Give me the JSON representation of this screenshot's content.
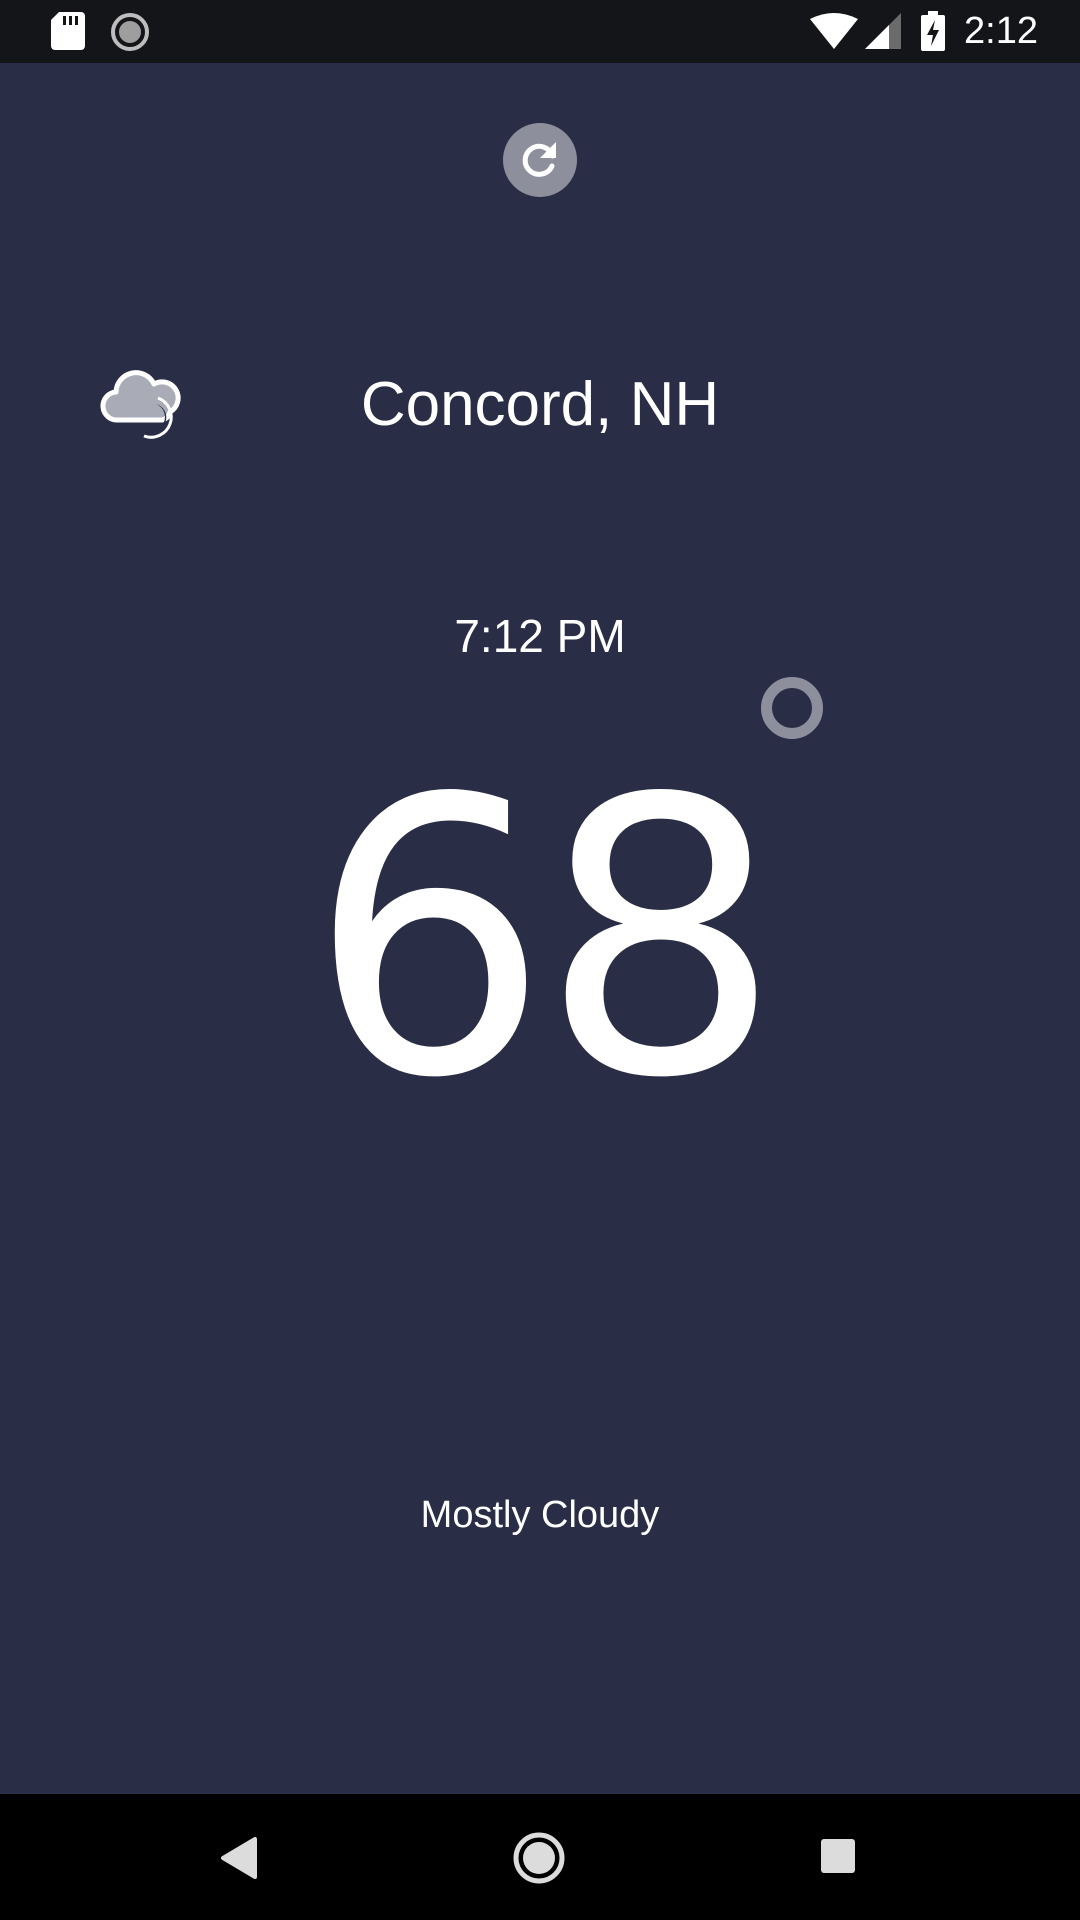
{
  "status_bar": {
    "time": "2:12",
    "icons": [
      "sd-card-icon",
      "sync-icon",
      "wifi-icon",
      "cell-signal-icon",
      "battery-charging-icon"
    ]
  },
  "weather": {
    "refresh_icon": "refresh-icon",
    "condition_icon": "partly-cloudy-night-icon",
    "city": "Concord, NH",
    "local_time": "7:12 PM",
    "temperature": "68",
    "condition": "Mostly Cloudy"
  },
  "nav_bar": {
    "icons": [
      "back-icon",
      "home-icon",
      "recents-icon"
    ]
  },
  "colors": {
    "background": "#2a2d46",
    "status_bar": "#141518",
    "accent_gray": "#8e8f9c",
    "text": "#ffffff",
    "nav_bar": "#000000"
  }
}
